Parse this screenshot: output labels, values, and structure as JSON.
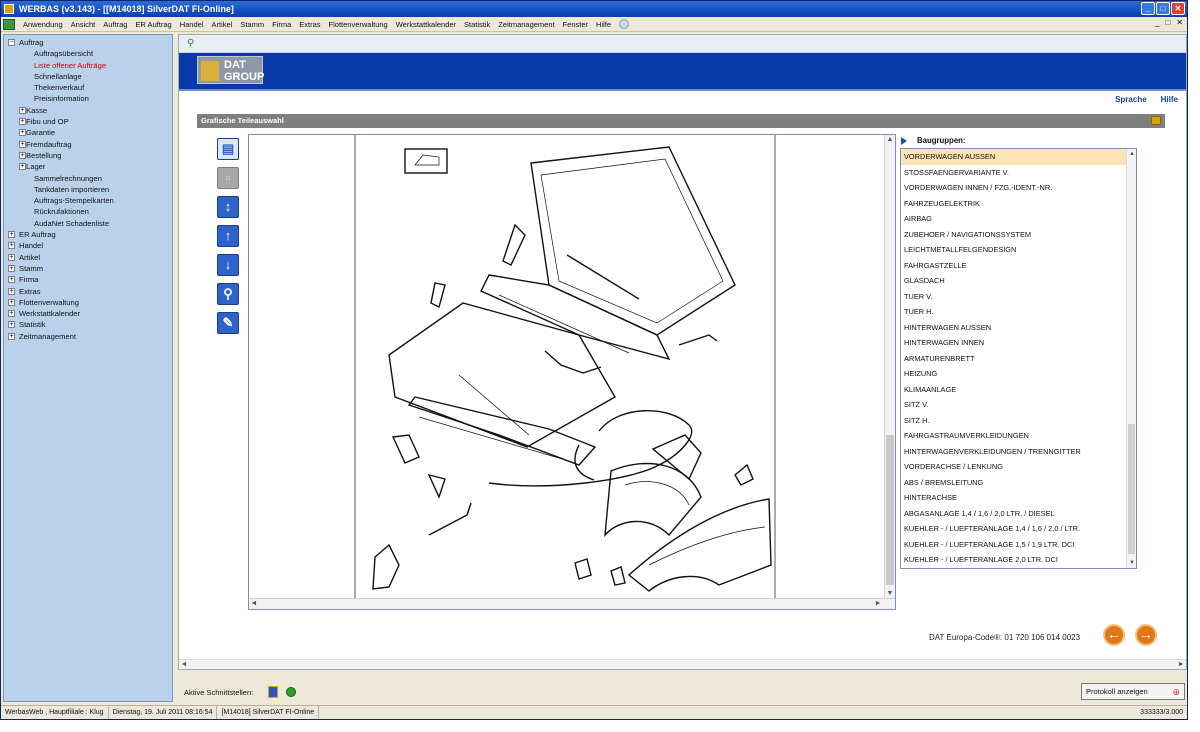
{
  "window": {
    "title": "WERBAS (v3.143) - [[M14018] SilverDAT FI-Online]",
    "min_label": "_",
    "max_label": "□",
    "close_label": "✕"
  },
  "menubar": {
    "items": [
      "Anwendung",
      "Ansicht",
      "Auftrag",
      "ER Auftrag",
      "Handel",
      "Artikel",
      "Stamm",
      "Firma",
      "Extras",
      "Flottenverwaltung",
      "Werkstattkalender",
      "Statistik",
      "Zeitmanagement",
      "Fenster",
      "Hilfe"
    ],
    "mdi_buttons": [
      "_",
      "□",
      "✕"
    ]
  },
  "sidebar": {
    "expand_symbol": "−",
    "collapse_symbol": "+",
    "tree": [
      {
        "label": "Auftrag",
        "level": 0,
        "expanded": true
      },
      {
        "label": "Auftragsübersicht",
        "level": 1
      },
      {
        "label": "Liste offener Aufträge",
        "level": 1,
        "highlight": true
      },
      {
        "label": "Schnellanlage",
        "level": 1
      },
      {
        "label": "Thekenverkauf",
        "level": 1
      },
      {
        "label": "Preisinformation",
        "level": 1
      },
      {
        "label": "Kasse",
        "level": 1,
        "expandable": true
      },
      {
        "label": "Fibu und OP",
        "level": 1,
        "expandable": true
      },
      {
        "label": "Garantie",
        "level": 1,
        "expandable": true
      },
      {
        "label": "Fremdauftrag",
        "level": 1,
        "expandable": true
      },
      {
        "label": "Bestellung",
        "level": 1,
        "expandable": true
      },
      {
        "label": "Lager",
        "level": 1,
        "expandable": true
      },
      {
        "label": "Sammelrechnungen",
        "level": 1
      },
      {
        "label": "Tankdaten importieren",
        "level": 1
      },
      {
        "label": "Auftrags-Stempelkarten",
        "level": 1
      },
      {
        "label": "Rückrufaktionen",
        "level": 1
      },
      {
        "label": "AudaNet Schadenliste",
        "level": 1
      },
      {
        "label": "ER Auftrag",
        "level": 0
      },
      {
        "label": "Handel",
        "level": 0
      },
      {
        "label": "Artikel",
        "level": 0
      },
      {
        "label": "Stamm",
        "level": 0
      },
      {
        "label": "Firma",
        "level": 0
      },
      {
        "label": "Extras",
        "level": 0
      },
      {
        "label": "Flottenverwaltung",
        "level": 0
      },
      {
        "label": "Werkstattkalender",
        "level": 0
      },
      {
        "label": "Statistik",
        "level": 0
      },
      {
        "label": "Zeitmanagement",
        "level": 0
      }
    ]
  },
  "main": {
    "toolbar_icon": "pin-icon",
    "logo_text_1": "DAT",
    "logo_text_2": "GROUP",
    "links": {
      "sprache": "Sprache",
      "hilfe": "Hilfe"
    },
    "section_title": "Grafische Teileauswahl",
    "tools": [
      {
        "name": "document-icon",
        "glyph": "▤"
      },
      {
        "name": "zoom-out-disabled-icon",
        "glyph": "▫"
      },
      {
        "name": "fit-view-icon",
        "glyph": "↕"
      },
      {
        "name": "arrow-up-icon",
        "glyph": "↑"
      },
      {
        "name": "arrow-down-icon",
        "glyph": "↓"
      },
      {
        "name": "magnifier-icon",
        "glyph": "⚲"
      },
      {
        "name": "pencil-icon",
        "glyph": "✎"
      }
    ],
    "baugruppen_title": "Baugruppen:",
    "baugruppen": [
      "VORDERWAGEN AUSSEN",
      "STOSSFAENGERVARIANTE V.",
      "VORDERWAGEN INNEN / FZG.-IDENT.-NR.",
      "FAHRZEUGELEKTRIK",
      "AIRBAG",
      "ZUBEHOER / NAVIGATIONSSYSTEM",
      "LEICHTMETALLFELGENDESIGN",
      "FAHRGASTZELLE",
      "GLASDACH",
      "TUER V.",
      "TUER H.",
      "HINTERWAGEN AUSSEN",
      "HINTERWAGEN INNEN",
      "ARMATURENBRETT",
      "HEIZUNG",
      "KLIMAANLAGE",
      "SITZ V.",
      "SITZ H.",
      "FAHRGASTRAUMVERKLEIDUNGEN",
      "HINTERWAGENVERKLEIDUNGEN / TRENNGITTER",
      "VORDERACHSE / LENKUNG",
      "ABS / BREMSLEITUNG",
      "HINTERACHSE",
      "ABGASANLAGE 1,4 / 1,6 / 2,0 LTR. / DIESEL",
      "KUEHLER - / LUEFTERANLAGE 1,4 / 1,6 / 2,0 / LTR.",
      "KUEHLER - / LUEFTERANLAGE 1,5 / 1,9 LTR. DCI",
      "KUEHLER - / LUEFTERANLAGE 2,0 LTR. DCI"
    ],
    "selected_index": 0,
    "europa_code": "DAT Europa-Code®: 01 720 106 014 0023",
    "nav_prev": "←",
    "nav_next": "→",
    "scroll_up": "▲",
    "scroll_down": "▼",
    "scroll_left": "◄",
    "scroll_right": "►"
  },
  "status_area": {
    "aktive_label": "Aktive Schnittstellen:",
    "protokoll_label": "Protokoll anzeigen",
    "protokoll_pin": "⊕"
  },
  "statusbar": {
    "user": "WerbasWeb , Hauptfiliale : Klug",
    "datetime": "Dienstag, 19. Juli 2011 08:16:54",
    "module": "[M14018] SilverDAT FI-Online",
    "memory": "333333/3.000"
  }
}
